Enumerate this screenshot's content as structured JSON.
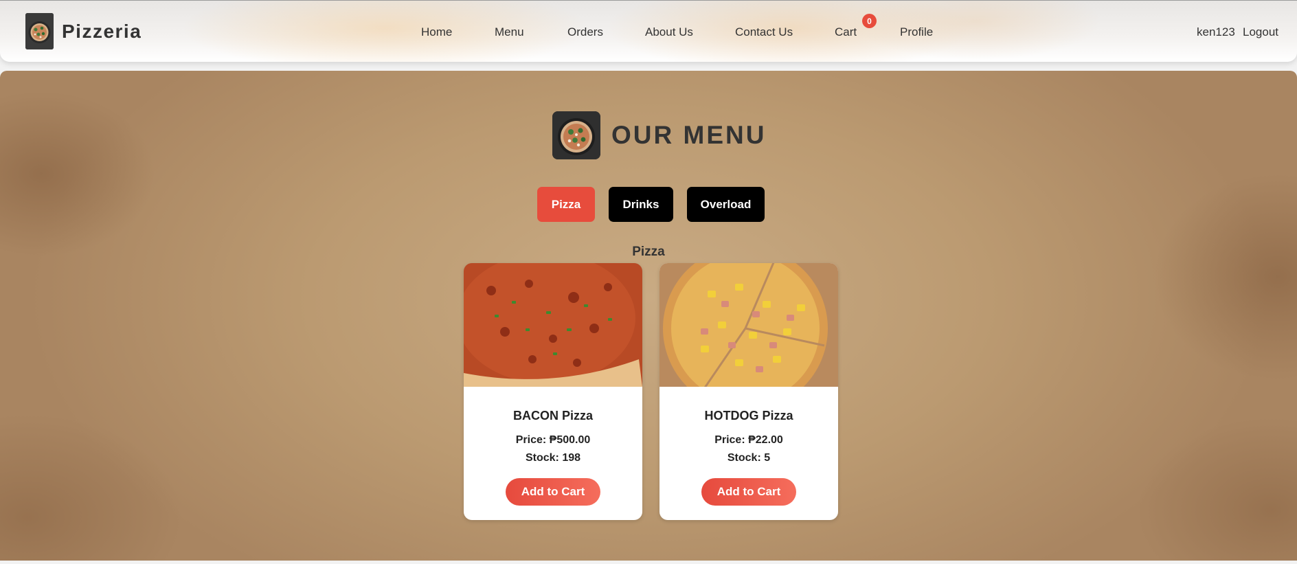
{
  "header": {
    "brand_name": "Pizzeria",
    "brand_icon": "pizza-logo-icon",
    "nav": {
      "home": "Home",
      "menu": "Menu",
      "orders": "Orders",
      "about": "About Us",
      "contact": "Contact Us",
      "cart": "Cart",
      "profile": "Profile"
    },
    "cart_count": "0",
    "username": "ken123",
    "logout": "Logout"
  },
  "main": {
    "title": "OUR MENU",
    "title_icon": "pizza-logo-icon",
    "categories": [
      {
        "label": "Pizza",
        "active": true,
        "color": "#e74c3c"
      },
      {
        "label": "Drinks",
        "active": false,
        "color": "#000000"
      },
      {
        "label": "Overload",
        "active": false,
        "color": "#000000"
      }
    ],
    "section_title": "Pizza",
    "products": [
      {
        "name": "BACON Pizza",
        "price": "Price: ₱500.00",
        "stock": "Stock: 198",
        "button": "Add to Cart",
        "image_icon": "bacon-pizza-image"
      },
      {
        "name": "HOTDOG Pizza",
        "price": "Price: ₱22.00",
        "stock": "Stock: 5",
        "button": "Add to Cart",
        "image_icon": "hotdog-pizza-image"
      }
    ]
  },
  "colors": {
    "accent": "#e74c3c",
    "text": "#333333",
    "background_paper": "#bb9a71"
  }
}
